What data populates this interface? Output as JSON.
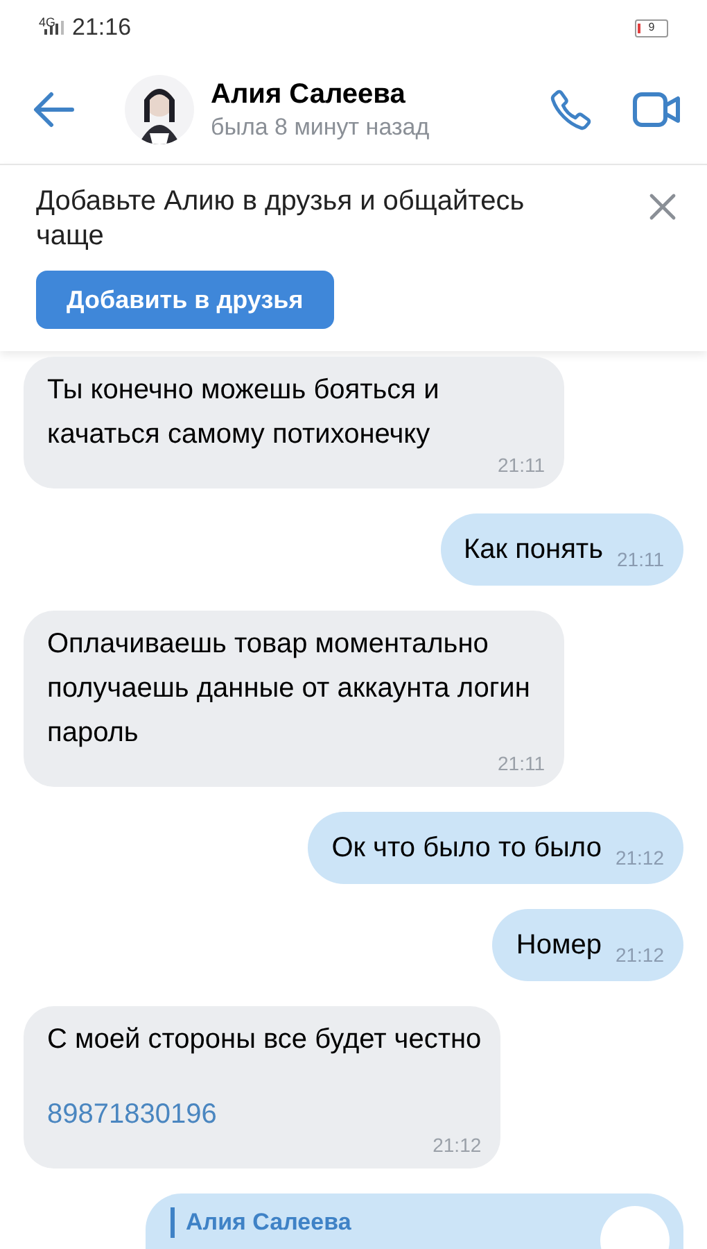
{
  "status_bar": {
    "network": "4G",
    "time": "21:16",
    "battery": "9"
  },
  "header": {
    "name": "Алия Салеева",
    "last_seen": "была 8 минут назад"
  },
  "banner": {
    "text": "Добавьте Алию в друзья и общайтесь чаще",
    "button": "Добавить в друзья"
  },
  "messages": [
    {
      "kind": "incoming",
      "text": "Ты конечно можешь бояться и качаться самому потихонечку",
      "time": "21:11"
    },
    {
      "kind": "outgoing",
      "text": "Как понять",
      "time": "21:11"
    },
    {
      "kind": "incoming",
      "text": "Оплачиваешь товар моментально получаешь данные от аккаунта логин пароль",
      "time": "21:11"
    },
    {
      "kind": "outgoing",
      "text": "Ок что было то было",
      "time": "21:12"
    },
    {
      "kind": "outgoing",
      "text": "Номер",
      "time": "21:12"
    },
    {
      "kind": "incoming",
      "text": "С моей стороны все будет честно",
      "link": "89871830196",
      "time": "21:12"
    },
    {
      "kind": "reply",
      "quote_author": "Алия Салеева"
    }
  ]
}
